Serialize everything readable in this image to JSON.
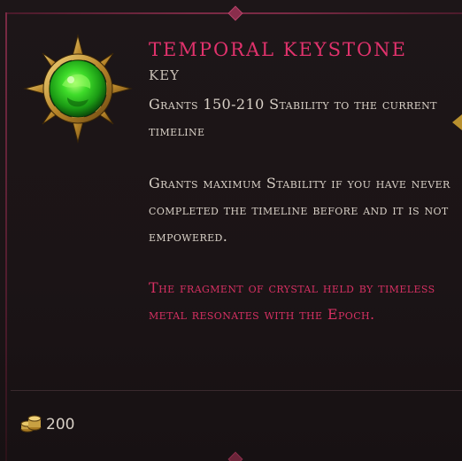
{
  "item": {
    "name": "Temporal Keystone",
    "type": "Key",
    "description_1": "Grants 150-210 Stability to the current timeline",
    "description_2": "Grants maximum Stability if you have never completed the timeline before and it is not empowered.",
    "lore": "The fragment of crystal held by timeless metal resonates with the Epoch.",
    "icon": "green-crystal-keystone-icon"
  },
  "price": {
    "amount": "200",
    "currency_icon": "gold-coins-icon"
  },
  "colors": {
    "title": "#e0326c",
    "lore": "#d63062",
    "body_text": "#d8d0c6",
    "frame_accent": "#7a2a44",
    "gem_green": "#3fdc2a",
    "gold": "#c8a042"
  }
}
